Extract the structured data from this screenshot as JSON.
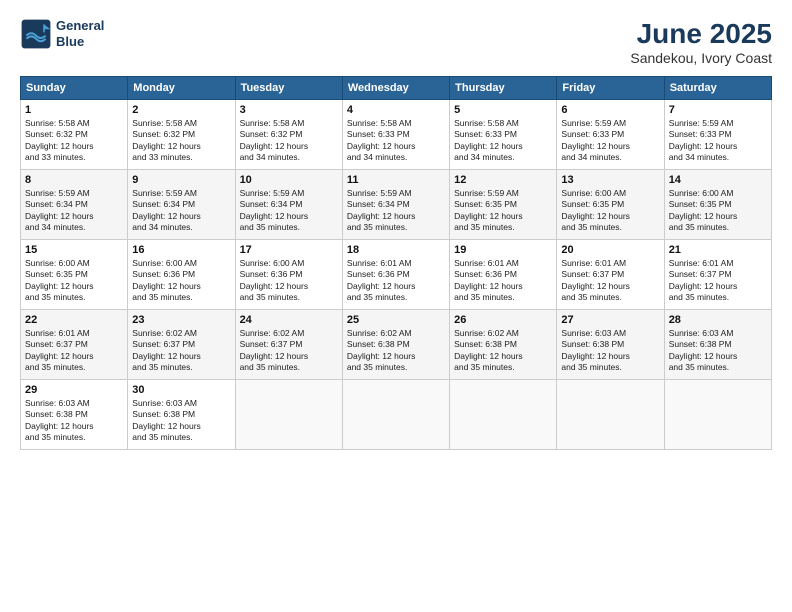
{
  "header": {
    "logo_line1": "General",
    "logo_line2": "Blue",
    "title": "June 2025",
    "subtitle": "Sandekou, Ivory Coast"
  },
  "days_of_week": [
    "Sunday",
    "Monday",
    "Tuesday",
    "Wednesday",
    "Thursday",
    "Friday",
    "Saturday"
  ],
  "weeks": [
    [
      {
        "day": "1",
        "info": "Sunrise: 5:58 AM\nSunset: 6:32 PM\nDaylight: 12 hours\nand 33 minutes."
      },
      {
        "day": "2",
        "info": "Sunrise: 5:58 AM\nSunset: 6:32 PM\nDaylight: 12 hours\nand 33 minutes."
      },
      {
        "day": "3",
        "info": "Sunrise: 5:58 AM\nSunset: 6:32 PM\nDaylight: 12 hours\nand 34 minutes."
      },
      {
        "day": "4",
        "info": "Sunrise: 5:58 AM\nSunset: 6:33 PM\nDaylight: 12 hours\nand 34 minutes."
      },
      {
        "day": "5",
        "info": "Sunrise: 5:58 AM\nSunset: 6:33 PM\nDaylight: 12 hours\nand 34 minutes."
      },
      {
        "day": "6",
        "info": "Sunrise: 5:59 AM\nSunset: 6:33 PM\nDaylight: 12 hours\nand 34 minutes."
      },
      {
        "day": "7",
        "info": "Sunrise: 5:59 AM\nSunset: 6:33 PM\nDaylight: 12 hours\nand 34 minutes."
      }
    ],
    [
      {
        "day": "8",
        "info": "Sunrise: 5:59 AM\nSunset: 6:34 PM\nDaylight: 12 hours\nand 34 minutes."
      },
      {
        "day": "9",
        "info": "Sunrise: 5:59 AM\nSunset: 6:34 PM\nDaylight: 12 hours\nand 34 minutes."
      },
      {
        "day": "10",
        "info": "Sunrise: 5:59 AM\nSunset: 6:34 PM\nDaylight: 12 hours\nand 35 minutes."
      },
      {
        "day": "11",
        "info": "Sunrise: 5:59 AM\nSunset: 6:34 PM\nDaylight: 12 hours\nand 35 minutes."
      },
      {
        "day": "12",
        "info": "Sunrise: 5:59 AM\nSunset: 6:35 PM\nDaylight: 12 hours\nand 35 minutes."
      },
      {
        "day": "13",
        "info": "Sunrise: 6:00 AM\nSunset: 6:35 PM\nDaylight: 12 hours\nand 35 minutes."
      },
      {
        "day": "14",
        "info": "Sunrise: 6:00 AM\nSunset: 6:35 PM\nDaylight: 12 hours\nand 35 minutes."
      }
    ],
    [
      {
        "day": "15",
        "info": "Sunrise: 6:00 AM\nSunset: 6:35 PM\nDaylight: 12 hours\nand 35 minutes."
      },
      {
        "day": "16",
        "info": "Sunrise: 6:00 AM\nSunset: 6:36 PM\nDaylight: 12 hours\nand 35 minutes."
      },
      {
        "day": "17",
        "info": "Sunrise: 6:00 AM\nSunset: 6:36 PM\nDaylight: 12 hours\nand 35 minutes."
      },
      {
        "day": "18",
        "info": "Sunrise: 6:01 AM\nSunset: 6:36 PM\nDaylight: 12 hours\nand 35 minutes."
      },
      {
        "day": "19",
        "info": "Sunrise: 6:01 AM\nSunset: 6:36 PM\nDaylight: 12 hours\nand 35 minutes."
      },
      {
        "day": "20",
        "info": "Sunrise: 6:01 AM\nSunset: 6:37 PM\nDaylight: 12 hours\nand 35 minutes."
      },
      {
        "day": "21",
        "info": "Sunrise: 6:01 AM\nSunset: 6:37 PM\nDaylight: 12 hours\nand 35 minutes."
      }
    ],
    [
      {
        "day": "22",
        "info": "Sunrise: 6:01 AM\nSunset: 6:37 PM\nDaylight: 12 hours\nand 35 minutes."
      },
      {
        "day": "23",
        "info": "Sunrise: 6:02 AM\nSunset: 6:37 PM\nDaylight: 12 hours\nand 35 minutes."
      },
      {
        "day": "24",
        "info": "Sunrise: 6:02 AM\nSunset: 6:37 PM\nDaylight: 12 hours\nand 35 minutes."
      },
      {
        "day": "25",
        "info": "Sunrise: 6:02 AM\nSunset: 6:38 PM\nDaylight: 12 hours\nand 35 minutes."
      },
      {
        "day": "26",
        "info": "Sunrise: 6:02 AM\nSunset: 6:38 PM\nDaylight: 12 hours\nand 35 minutes."
      },
      {
        "day": "27",
        "info": "Sunrise: 6:03 AM\nSunset: 6:38 PM\nDaylight: 12 hours\nand 35 minutes."
      },
      {
        "day": "28",
        "info": "Sunrise: 6:03 AM\nSunset: 6:38 PM\nDaylight: 12 hours\nand 35 minutes."
      }
    ],
    [
      {
        "day": "29",
        "info": "Sunrise: 6:03 AM\nSunset: 6:38 PM\nDaylight: 12 hours\nand 35 minutes."
      },
      {
        "day": "30",
        "info": "Sunrise: 6:03 AM\nSunset: 6:38 PM\nDaylight: 12 hours\nand 35 minutes."
      },
      {
        "day": "",
        "info": ""
      },
      {
        "day": "",
        "info": ""
      },
      {
        "day": "",
        "info": ""
      },
      {
        "day": "",
        "info": ""
      },
      {
        "day": "",
        "info": ""
      }
    ]
  ]
}
